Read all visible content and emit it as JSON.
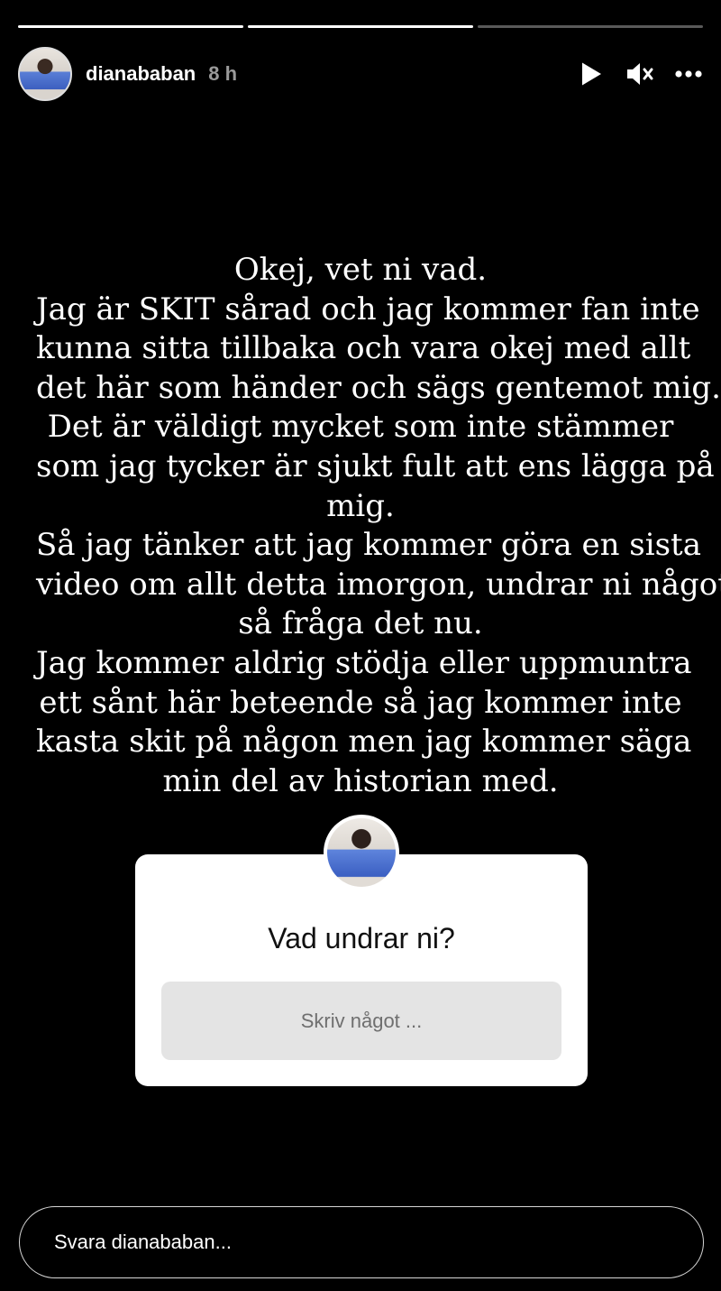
{
  "progress": [
    1,
    1,
    0
  ],
  "header": {
    "username": "dianababan",
    "time": "8 h"
  },
  "controls": [
    "play-icon",
    "muted-speaker-icon",
    "more-icon"
  ],
  "caption": {
    "lines": [
      "Okej, vet ni vad.",
      "Jag är SKIT sårad och jag kommer fan inte",
      "kunna sitta tillbaka och vara okej med allt",
      "det här som händer och sägs gentemot mig.",
      "Det är väldigt mycket som inte stämmer",
      "som jag tycker är sjukt fult att ens lägga på",
      "mig.",
      "Så jag tänker att jag kommer göra en sista",
      "video om allt detta imorgon, undrar ni något",
      "så fråga det nu.",
      "Jag kommer aldrig stödja eller uppmuntra",
      "ett sånt här beteende så jag kommer inte",
      "kasta skit på någon men jag kommer säga",
      "min del av historian med."
    ]
  },
  "sticker": {
    "question": "Vad undrar ni?",
    "placeholder": "Skriv något ..."
  },
  "reply": {
    "placeholder": "Svara dianababan..."
  }
}
